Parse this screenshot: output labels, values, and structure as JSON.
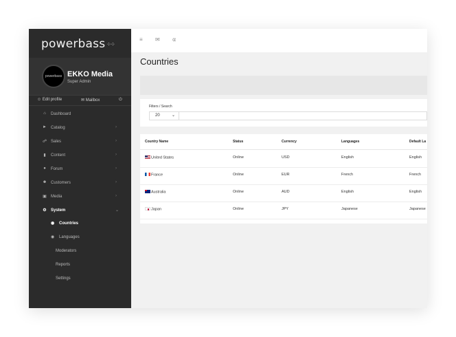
{
  "sidebar": {
    "logo": "powerbass",
    "logo_mark": "⁘⁘",
    "profile": {
      "name": "EKKO Media",
      "role": "Super Admin",
      "avatar_text": "powerbass"
    },
    "actions": {
      "edit_profile": "Edit profile",
      "mailbox": "Mailbox"
    },
    "nav": [
      {
        "label": "Dashboard",
        "icon": "home-icon"
      },
      {
        "label": "Catalog",
        "icon": "tag-icon"
      },
      {
        "label": "Sales",
        "icon": "cart-icon"
      },
      {
        "label": "Content",
        "icon": "chart-icon"
      },
      {
        "label": "Forum",
        "icon": "chat-icon"
      },
      {
        "label": "Customers",
        "icon": "users-icon"
      },
      {
        "label": "Media",
        "icon": "media-icon"
      },
      {
        "label": "System",
        "icon": "gears-icon"
      }
    ],
    "system_sub": [
      {
        "label": "Countries"
      },
      {
        "label": "Languages"
      },
      {
        "label": "Moderators"
      },
      {
        "label": "Reports"
      },
      {
        "label": "Settings"
      }
    ]
  },
  "page": {
    "title": "Countries"
  },
  "filters": {
    "title": "Filters / Search",
    "per_page": "20"
  },
  "table": {
    "headers": [
      "Country Name",
      "Status",
      "Currency",
      "Languages",
      "Default La"
    ],
    "rows": [
      {
        "country": "United States",
        "status": "Online",
        "currency": "USD",
        "languages": "English",
        "default": "English"
      },
      {
        "country": "France",
        "status": "Online",
        "currency": "EUR",
        "languages": "French",
        "default": "French"
      },
      {
        "country": "Australia",
        "status": "Online",
        "currency": "AUD",
        "languages": "English",
        "default": "English"
      },
      {
        "country": "Japan",
        "status": "Online",
        "currency": "JPY",
        "languages": "Japanese",
        "default": "Japanese"
      }
    ]
  },
  "colors": {
    "sidebar_bg": "#2b2b2b",
    "profile_bg": "#333333",
    "content_bg": "#f1f1f1"
  }
}
